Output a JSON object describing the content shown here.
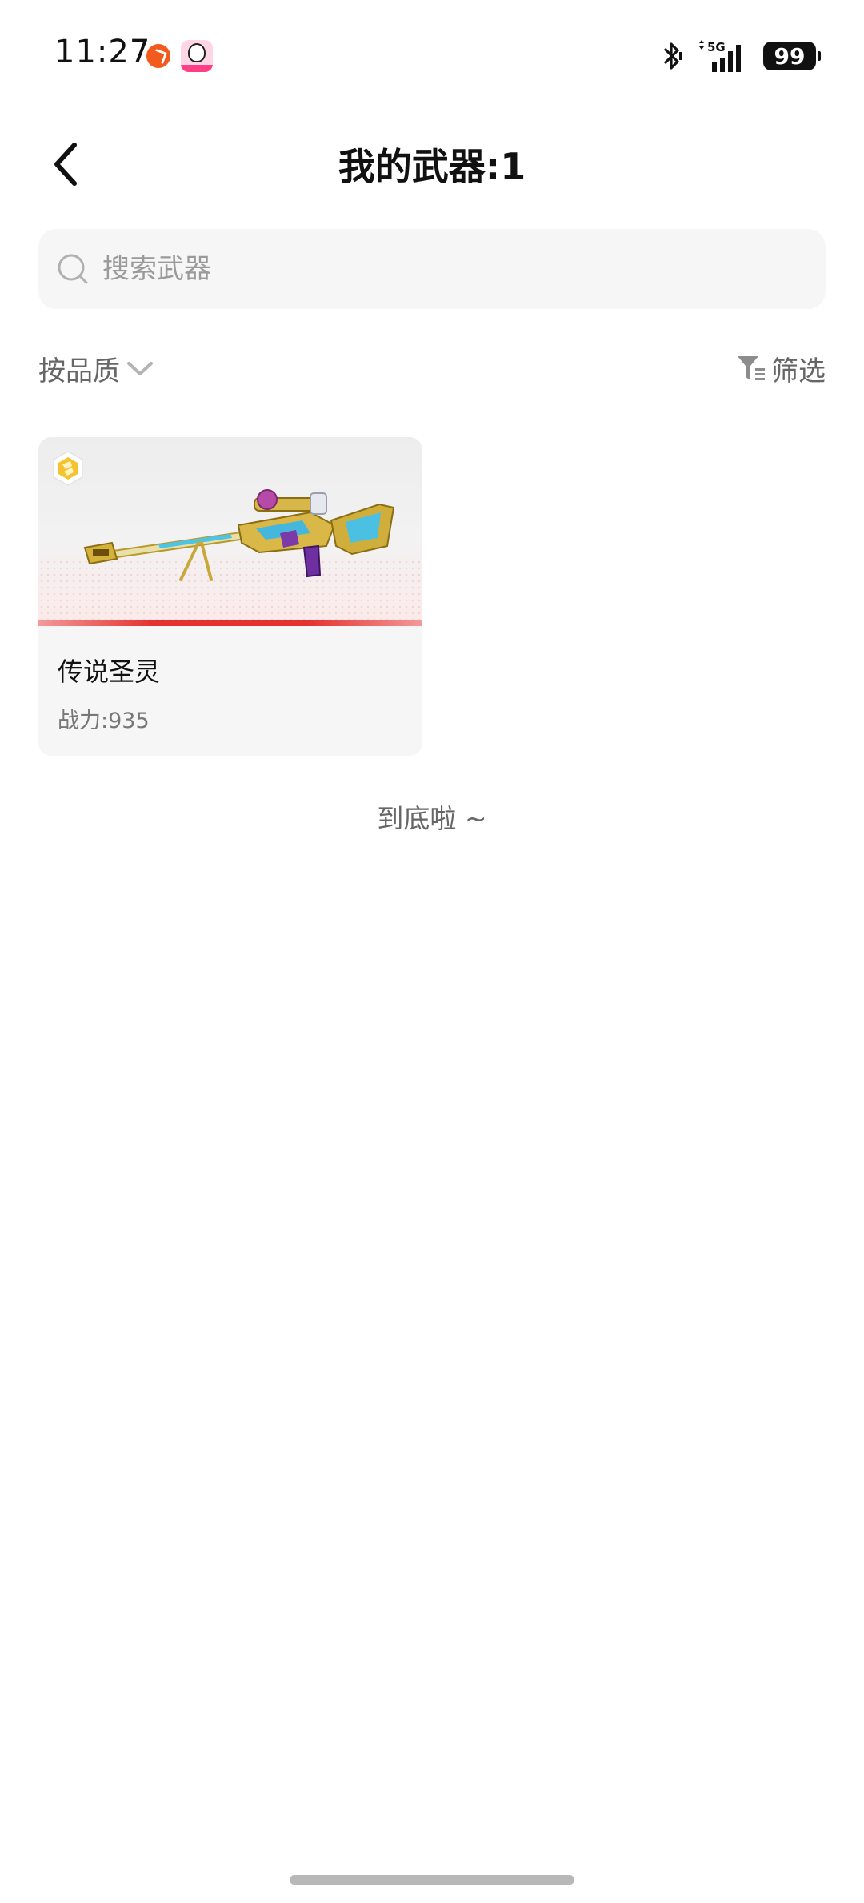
{
  "status_bar": {
    "time": "11:27",
    "network": "5G",
    "battery": "99"
  },
  "header": {
    "title": "我的武器:1"
  },
  "search": {
    "placeholder": "搜索武器"
  },
  "sort": {
    "label": "按品质"
  },
  "filter": {
    "label": "筛选"
  },
  "weapons": [
    {
      "name": "传说圣灵",
      "power": "战力:935",
      "quality_color": "#e4322d",
      "rarity_icon": "diamond-rarity-icon"
    }
  ],
  "footer": {
    "end_text": "到底啦 ~"
  }
}
